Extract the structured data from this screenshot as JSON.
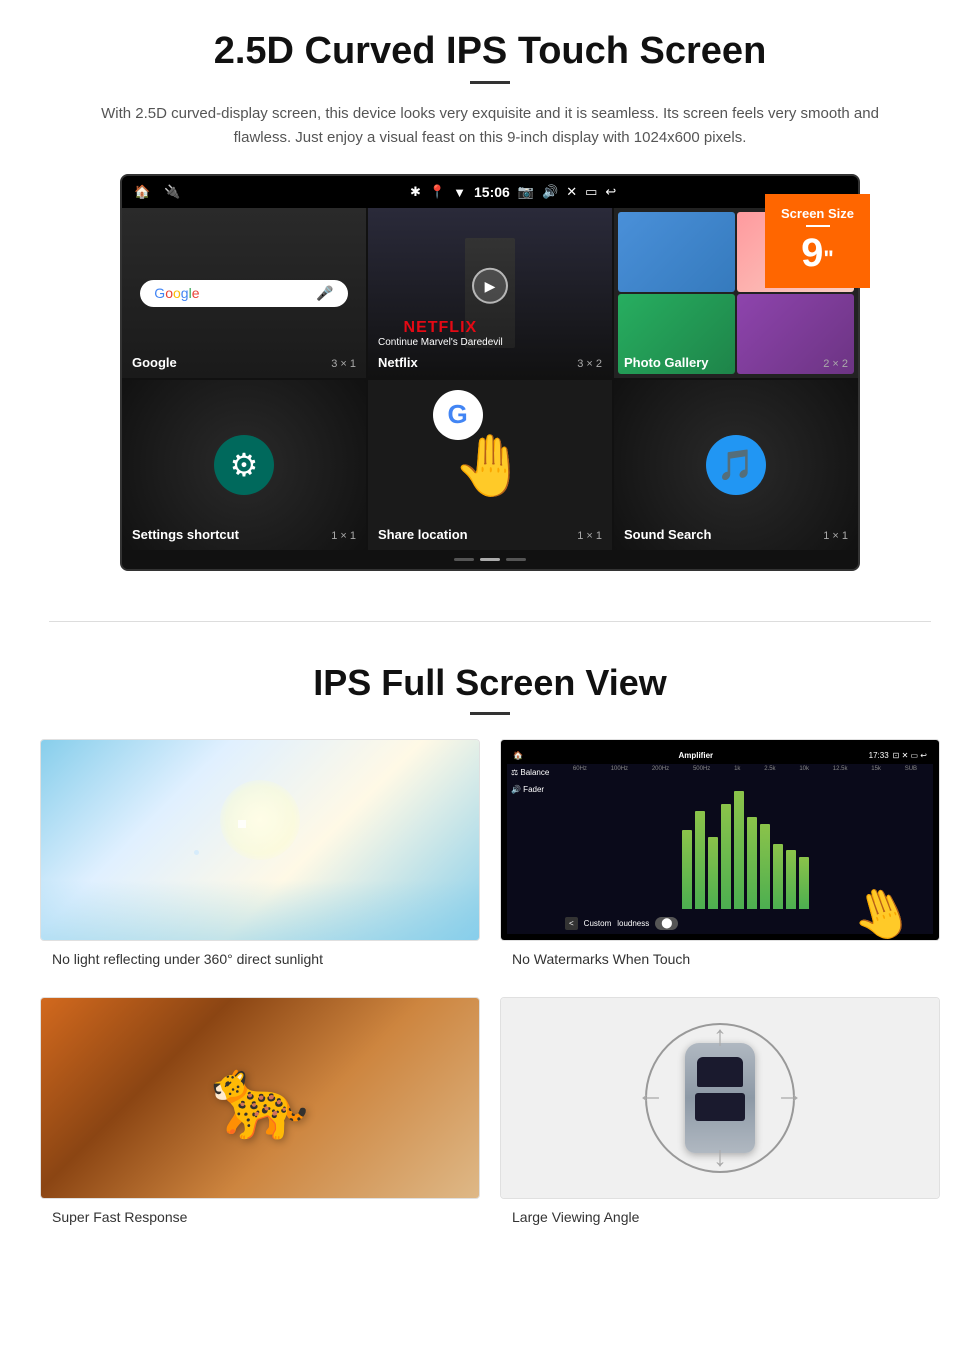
{
  "section1": {
    "title": "2.5D Curved IPS Touch Screen",
    "description": "With 2.5D curved-display screen, this device looks very exquisite and it is seamless. Its screen feels very smooth and flawless. Just enjoy a visual feast on this 9-inch display with 1024x600 pixels.",
    "badge": {
      "title": "Screen Size",
      "size": "9",
      "unit": "\""
    },
    "statusbar": {
      "time": "15:06"
    },
    "apps": [
      {
        "label": "Google",
        "size": "3 × 1"
      },
      {
        "label": "Netflix",
        "size": "3 × 2"
      },
      {
        "label": "Photo Gallery",
        "size": "2 × 2"
      },
      {
        "label": "Settings shortcut",
        "size": "1 × 1"
      },
      {
        "label": "Share location",
        "size": "1 × 1"
      },
      {
        "label": "Sound Search",
        "size": "1 × 1"
      }
    ],
    "netflix": {
      "brand": "NETFLIX",
      "subtitle": "Continue Marvel's Daredevil"
    }
  },
  "section2": {
    "title": "IPS Full Screen View",
    "images": [
      {
        "caption": "No light reflecting under 360° direct sunlight"
      },
      {
        "caption": "No Watermarks When Touch"
      },
      {
        "caption": "Super Fast Response"
      },
      {
        "caption": "Large Viewing Angle"
      }
    ]
  }
}
